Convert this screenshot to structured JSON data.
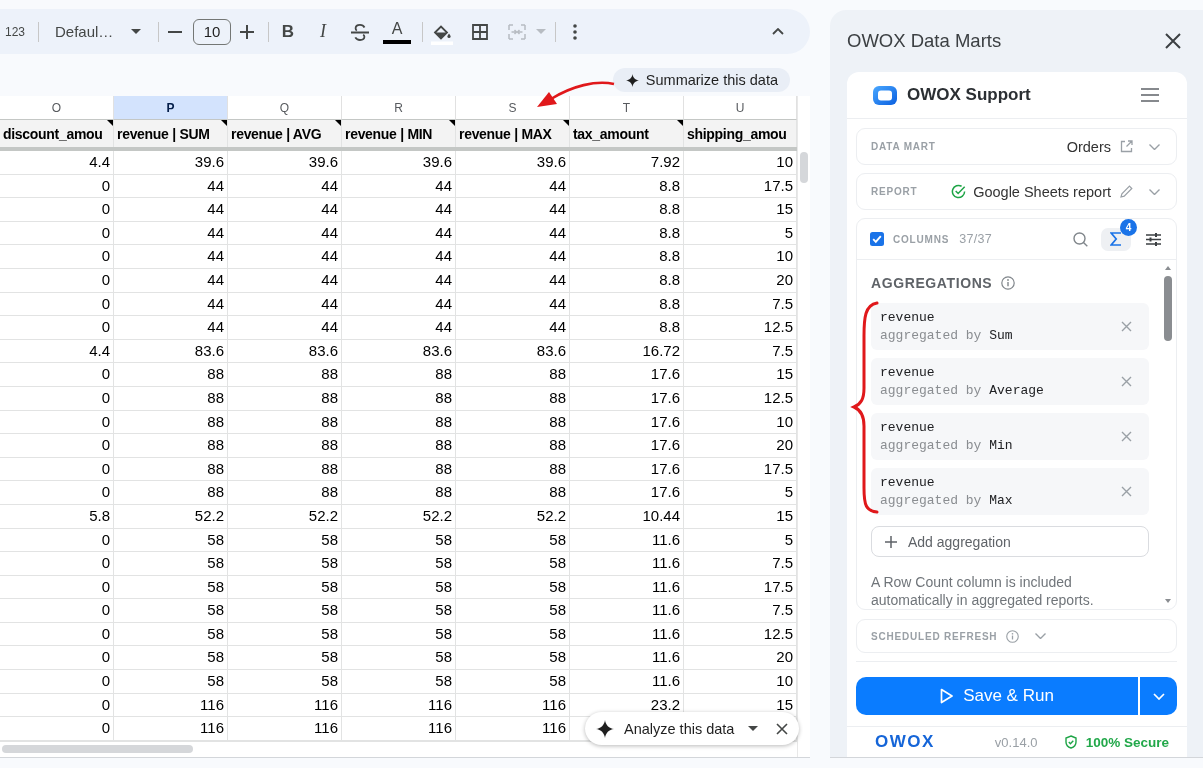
{
  "toolbar": {
    "number_format": "123",
    "font": "Defaul…",
    "font_size": "10",
    "bold": "B",
    "italic": "I",
    "text_color": "A",
    "merge_disabled": true
  },
  "summarize_chip": "Summarize this data",
  "sheet": {
    "columns": [
      {
        "letter": "O",
        "selected": false,
        "header": "discount_amou",
        "has_note": true
      },
      {
        "letter": "P",
        "selected": true,
        "header": "revenue | SUM",
        "has_note": true
      },
      {
        "letter": "Q",
        "selected": false,
        "header": "revenue | AVG",
        "has_note": true
      },
      {
        "letter": "R",
        "selected": false,
        "header": "revenue | MIN",
        "has_note": true
      },
      {
        "letter": "S",
        "selected": false,
        "header": "revenue | MAX",
        "has_note": true
      },
      {
        "letter": "T",
        "selected": false,
        "header": "tax_amount",
        "has_note": true
      },
      {
        "letter": "U",
        "selected": false,
        "header": "shipping_amou",
        "has_note": false
      }
    ],
    "rows": [
      [
        "4.4",
        "39.6",
        "39.6",
        "39.6",
        "39.6",
        "7.92",
        "10"
      ],
      [
        "0",
        "44",
        "44",
        "44",
        "44",
        "8.8",
        "17.5"
      ],
      [
        "0",
        "44",
        "44",
        "44",
        "44",
        "8.8",
        "15"
      ],
      [
        "0",
        "44",
        "44",
        "44",
        "44",
        "8.8",
        "5"
      ],
      [
        "0",
        "44",
        "44",
        "44",
        "44",
        "8.8",
        "10"
      ],
      [
        "0",
        "44",
        "44",
        "44",
        "44",
        "8.8",
        "20"
      ],
      [
        "0",
        "44",
        "44",
        "44",
        "44",
        "8.8",
        "7.5"
      ],
      [
        "0",
        "44",
        "44",
        "44",
        "44",
        "8.8",
        "12.5"
      ],
      [
        "4.4",
        "83.6",
        "83.6",
        "83.6",
        "83.6",
        "16.72",
        "7.5"
      ],
      [
        "0",
        "88",
        "88",
        "88",
        "88",
        "17.6",
        "15"
      ],
      [
        "0",
        "88",
        "88",
        "88",
        "88",
        "17.6",
        "12.5"
      ],
      [
        "0",
        "88",
        "88",
        "88",
        "88",
        "17.6",
        "10"
      ],
      [
        "0",
        "88",
        "88",
        "88",
        "88",
        "17.6",
        "20"
      ],
      [
        "0",
        "88",
        "88",
        "88",
        "88",
        "17.6",
        "17.5"
      ],
      [
        "0",
        "88",
        "88",
        "88",
        "88",
        "17.6",
        "5"
      ],
      [
        "5.8",
        "52.2",
        "52.2",
        "52.2",
        "52.2",
        "10.44",
        "15"
      ],
      [
        "0",
        "58",
        "58",
        "58",
        "58",
        "11.6",
        "5"
      ],
      [
        "0",
        "58",
        "58",
        "58",
        "58",
        "11.6",
        "7.5"
      ],
      [
        "0",
        "58",
        "58",
        "58",
        "58",
        "11.6",
        "17.5"
      ],
      [
        "0",
        "58",
        "58",
        "58",
        "58",
        "11.6",
        "7.5"
      ],
      [
        "0",
        "58",
        "58",
        "58",
        "58",
        "11.6",
        "12.5"
      ],
      [
        "0",
        "58",
        "58",
        "58",
        "58",
        "11.6",
        "20"
      ],
      [
        "0",
        "58",
        "58",
        "58",
        "58",
        "11.6",
        "10"
      ],
      [
        "0",
        "116",
        "116",
        "116",
        "116",
        "23.2",
        "15"
      ],
      [
        "0",
        "116",
        "116",
        "116",
        "116"
      ]
    ]
  },
  "analyze_chip": "Analyze this data",
  "panel": {
    "title": "OWOX Data Marts",
    "workspace": "OWOX Support",
    "data_mart": {
      "label": "DATA MART",
      "value": "Orders"
    },
    "report": {
      "label": "REPORT",
      "value": "Google Sheets report",
      "verified": true
    },
    "columns": {
      "checked": true,
      "label": "COLUMNS",
      "count": "37/37",
      "aggregations_active": true,
      "badge": "4"
    },
    "aggregations": {
      "title": "AGGREGATIONS",
      "items": [
        {
          "field": "revenue",
          "by_label": "aggregated by",
          "function": "Sum"
        },
        {
          "field": "revenue",
          "by_label": "aggregated by",
          "function": "Average"
        },
        {
          "field": "revenue",
          "by_label": "aggregated by",
          "function": "Min"
        },
        {
          "field": "revenue",
          "by_label": "aggregated by",
          "function": "Max"
        }
      ],
      "add_label": "Add aggregation",
      "note": "A Row Count column is included automatically in aggregated reports."
    },
    "scheduled_refresh": {
      "label": "SCHEDULED REFRESH"
    },
    "run_button": "Save & Run",
    "footer": {
      "logo": "OWOX",
      "version": "v0.14.0",
      "security": "100% Secure"
    }
  }
}
